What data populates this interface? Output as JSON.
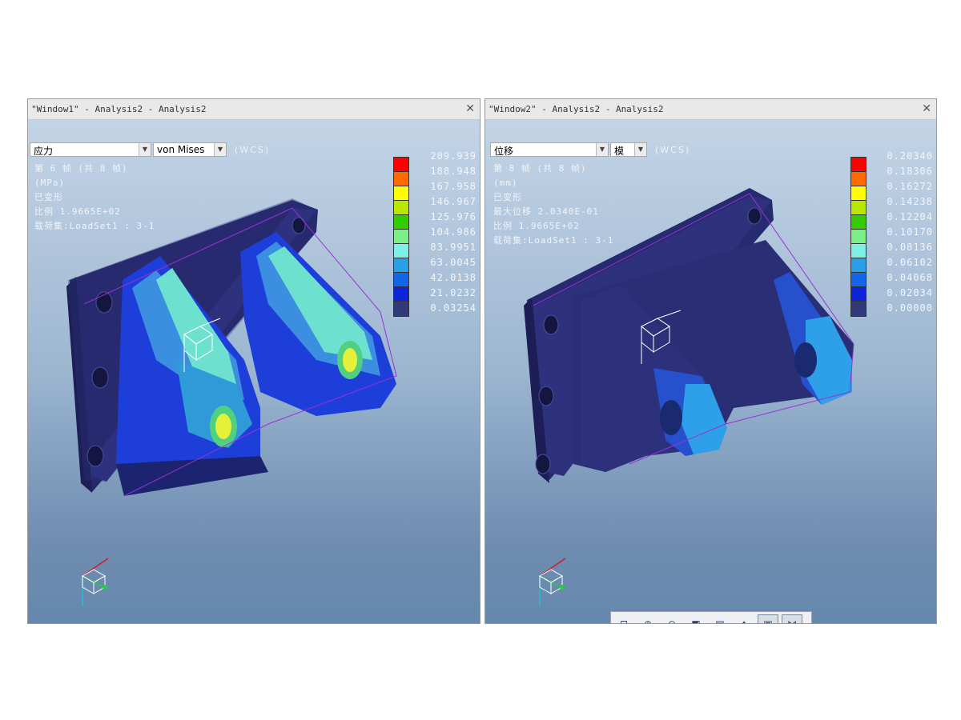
{
  "window1": {
    "title": "\"Window1\" - Analysis2 - Analysis2",
    "quantity": "应力",
    "component": "von Mises",
    "wcs": "(WCS)",
    "info": [
      "第 6 帧 (共 8 帧)",
      "(MPa)",
      "已变形",
      "比例  1.9665E+02",
      "载荷集:LoadSet1  :  3-1"
    ],
    "legend_values": [
      "209.939",
      "188.948",
      "167.958",
      "146.967",
      "125.976",
      "104.986",
      "83.9951",
      "63.0045",
      "42.0138",
      "21.0232",
      "0.03254"
    ]
  },
  "window2": {
    "title": "\"Window2\" - Analysis2 - Analysis2",
    "quantity": "位移",
    "component": "模",
    "wcs": "(WCS)",
    "info": [
      "第 8 帧 (共 8 帧)",
      "(mm)",
      "已变形",
      "最大位移  2.0340E-01",
      "比例  1.9665E+02",
      "载荷集:LoadSet1  :  3-1"
    ],
    "legend_values": [
      "0.20340",
      "0.18306",
      "0.16272",
      "0.14238",
      "0.12204",
      "0.10170",
      "0.08136",
      "0.06102",
      "0.04068",
      "0.02034",
      "0.00000"
    ]
  },
  "legend_colors": [
    "#ff0000",
    "#ff6a00",
    "#ffff00",
    "#b8e800",
    "#33cc00",
    "#7cee88",
    "#7ef0e6",
    "#2b9fe6",
    "#1466e8",
    "#0c24d8",
    "#303a78"
  ],
  "close_icon": "close-icon",
  "toolbar": {
    "icons": [
      "zoom-window-icon",
      "zoom-in-icon",
      "zoom-out-icon",
      "refit-icon",
      "view-manager-icon",
      "spin-center-icon",
      "display-style-icon",
      "datum-display-icon"
    ]
  }
}
